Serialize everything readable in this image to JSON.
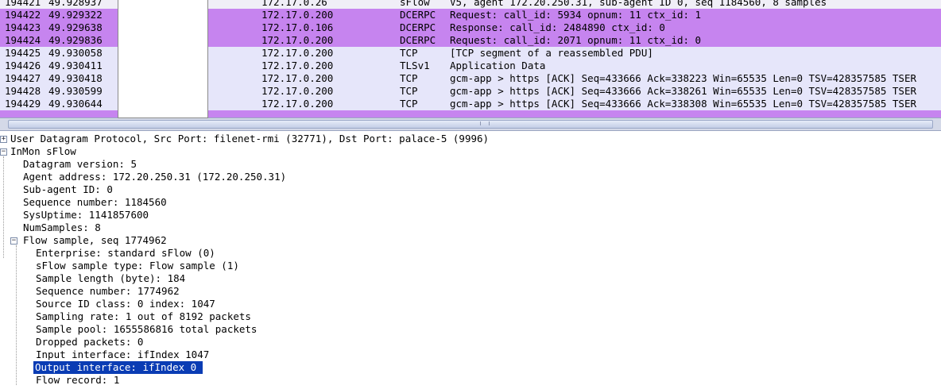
{
  "packets": [
    {
      "no": "194421",
      "time": "49.928937",
      "dst": "172.17.0.26",
      "proto": "sFlow",
      "info": "V5, agent 172.20.250.31, sub-agent ID 0, seq 1184560, 8 samples",
      "bg": "#f0eef7"
    },
    {
      "no": "194422",
      "time": "49.929322",
      "dst": "172.17.0.200",
      "proto": "DCERPC",
      "info": "Request: call_id: 5934 opnum: 11 ctx_id: 1",
      "bg": "#c684ef"
    },
    {
      "no": "194423",
      "time": "49.929638",
      "dst": "172.17.0.106",
      "proto": "DCERPC",
      "info": "Response: call_id: 2484890 ctx_id: 0",
      "bg": "#c684ef"
    },
    {
      "no": "194424",
      "time": "49.929836",
      "dst": "172.17.0.200",
      "proto": "DCERPC",
      "info": "Request: call_id: 2071 opnum: 11 ctx_id: 0",
      "bg": "#c684ef"
    },
    {
      "no": "194425",
      "time": "49.930058",
      "dst": "172.17.0.200",
      "proto": "TCP",
      "info": "[TCP segment of a reassembled PDU]",
      "bg": "#e6e6fa"
    },
    {
      "no": "194426",
      "time": "49.930411",
      "dst": "172.17.0.200",
      "proto": "TLSv1",
      "info": "Application Data",
      "bg": "#e6e6fa"
    },
    {
      "no": "194427",
      "time": "49.930418",
      "dst": "172.17.0.200",
      "proto": "TCP",
      "info": "gcm-app > https [ACK] Seq=433666 Ack=338223 Win=65535 Len=0 TSV=428357585 TSER",
      "bg": "#e6e6fa"
    },
    {
      "no": "194428",
      "time": "49.930599",
      "dst": "172.17.0.200",
      "proto": "TCP",
      "info": "gcm-app > https [ACK] Seq=433666 Ack=338261 Win=65535 Len=0 TSV=428357585 TSER",
      "bg": "#e6e6fa"
    },
    {
      "no": "194429",
      "time": "49.930644",
      "dst": "172.17.0.200",
      "proto": "TCP",
      "info": "gcm-app > https [ACK] Seq=433666 Ack=338308 Win=65535 Len=0 TSV=428357585 TSER",
      "bg": "#e6e6fa"
    }
  ],
  "tree": {
    "udp": "User Datagram Protocol, Src Port: filenet-rmi (32771), Dst Port: palace-5 (9996)",
    "inmon": "InMon sFlow",
    "inmon_fields": [
      "Datagram version: 5",
      "Agent address: 172.20.250.31 (172.20.250.31)",
      "Sub-agent ID: 0",
      "Sequence number: 1184560",
      "SysUptime: 1141857600",
      "NumSamples: 8"
    ],
    "flow_sample": "Flow sample, seq 1774962",
    "flow_fields": [
      "Enterprise: standard sFlow (0)",
      "sFlow sample type: Flow sample (1)",
      "Sample length (byte): 184",
      "Sequence number: 1774962",
      "Source ID class: 0 index: 1047",
      "Sampling rate: 1 out of 8192 packets",
      "Sample pool: 1655586816 total packets",
      "Dropped packets: 0",
      "Input interface: ifIndex 1047",
      "Output interface: ifIndex 0",
      "Flow record: 1"
    ],
    "selected_index": 9,
    "expand_collapsed": "+",
    "expand_open": "−"
  },
  "colors": {
    "selection": "#0a3cb4",
    "dcerpc_row": "#c684ef",
    "tcp_row": "#e6e6fa"
  }
}
